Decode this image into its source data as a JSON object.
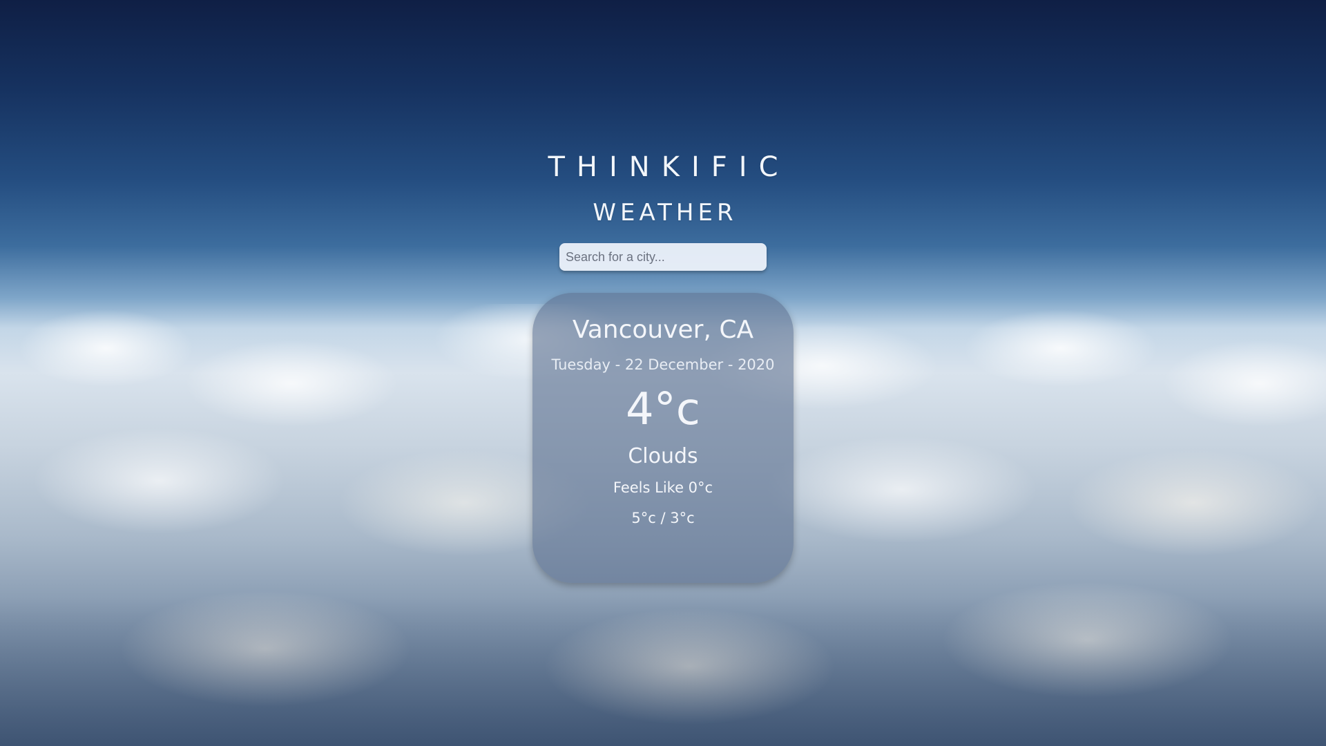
{
  "app": {
    "brand": "THINKIFIC",
    "subtitle": "WEATHER"
  },
  "search": {
    "placeholder": "Search for a city...",
    "value": ""
  },
  "weather": {
    "city": "Vancouver, CA",
    "date": "Tuesday - 22 December - 2020",
    "temperature": "4°c",
    "condition": "Clouds",
    "feels_like": "Feels Like 0°c",
    "high_low": "5°c / 3°c"
  },
  "colors": {
    "card_background": "#5f7391",
    "text": "#ffffff",
    "sky_top": "#0f1f45"
  }
}
